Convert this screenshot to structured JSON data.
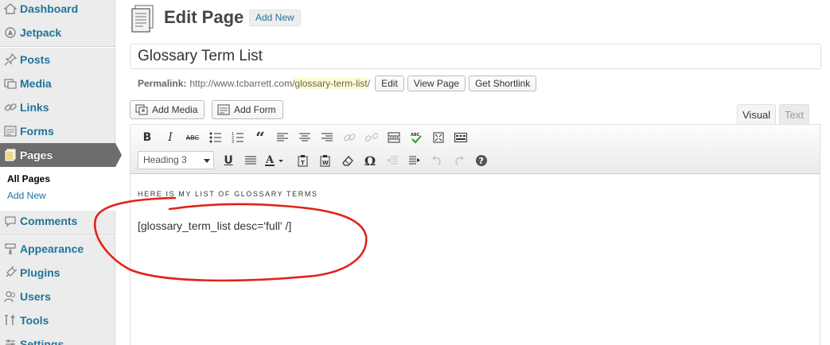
{
  "sidebar": {
    "items": [
      {
        "label": "Dashboard",
        "icon": "dashboard-icon"
      },
      {
        "label": "Jetpack",
        "icon": "jetpack-icon"
      },
      {
        "label": "Posts",
        "icon": "pushpin-icon"
      },
      {
        "label": "Media",
        "icon": "media-icon"
      },
      {
        "label": "Links",
        "icon": "link-icon"
      },
      {
        "label": "Forms",
        "icon": "form-icon"
      },
      {
        "label": "Pages",
        "icon": "pages-icon"
      },
      {
        "label": "Comments",
        "icon": "comment-icon"
      },
      {
        "label": "Appearance",
        "icon": "appearance-icon"
      },
      {
        "label": "Plugins",
        "icon": "plugin-icon"
      },
      {
        "label": "Users",
        "icon": "users-icon"
      },
      {
        "label": "Tools",
        "icon": "tools-icon"
      },
      {
        "label": "Settings",
        "icon": "settings-icon"
      }
    ],
    "submenu": {
      "all_pages": "All Pages",
      "add_new": "Add New"
    }
  },
  "header": {
    "title": "Edit Page",
    "add_new": "Add New"
  },
  "post": {
    "title": "Glossary Term List"
  },
  "permalink": {
    "label": "Permalink:",
    "base": "http://www.tcbarrett.com/",
    "slug": "glossary-term-list",
    "trail": "/",
    "edit": "Edit",
    "view_page": "View Page",
    "get_shortlink": "Get Shortlink"
  },
  "media_buttons": {
    "add_media": "Add Media",
    "add_form": "Add Form"
  },
  "editor": {
    "tab_visual": "Visual",
    "tab_text": "Text",
    "format_select": "Heading 3",
    "content_heading": "HERE IS MY LIST OF GLOSSARY TERMS",
    "content_shortcode": "[glossary_term_list desc='full' /]"
  },
  "colors": {
    "link": "#21759b",
    "active_menu": "#6d6d6d",
    "annotation": "#e2231a",
    "slug_highlight": "#fffbcc"
  }
}
